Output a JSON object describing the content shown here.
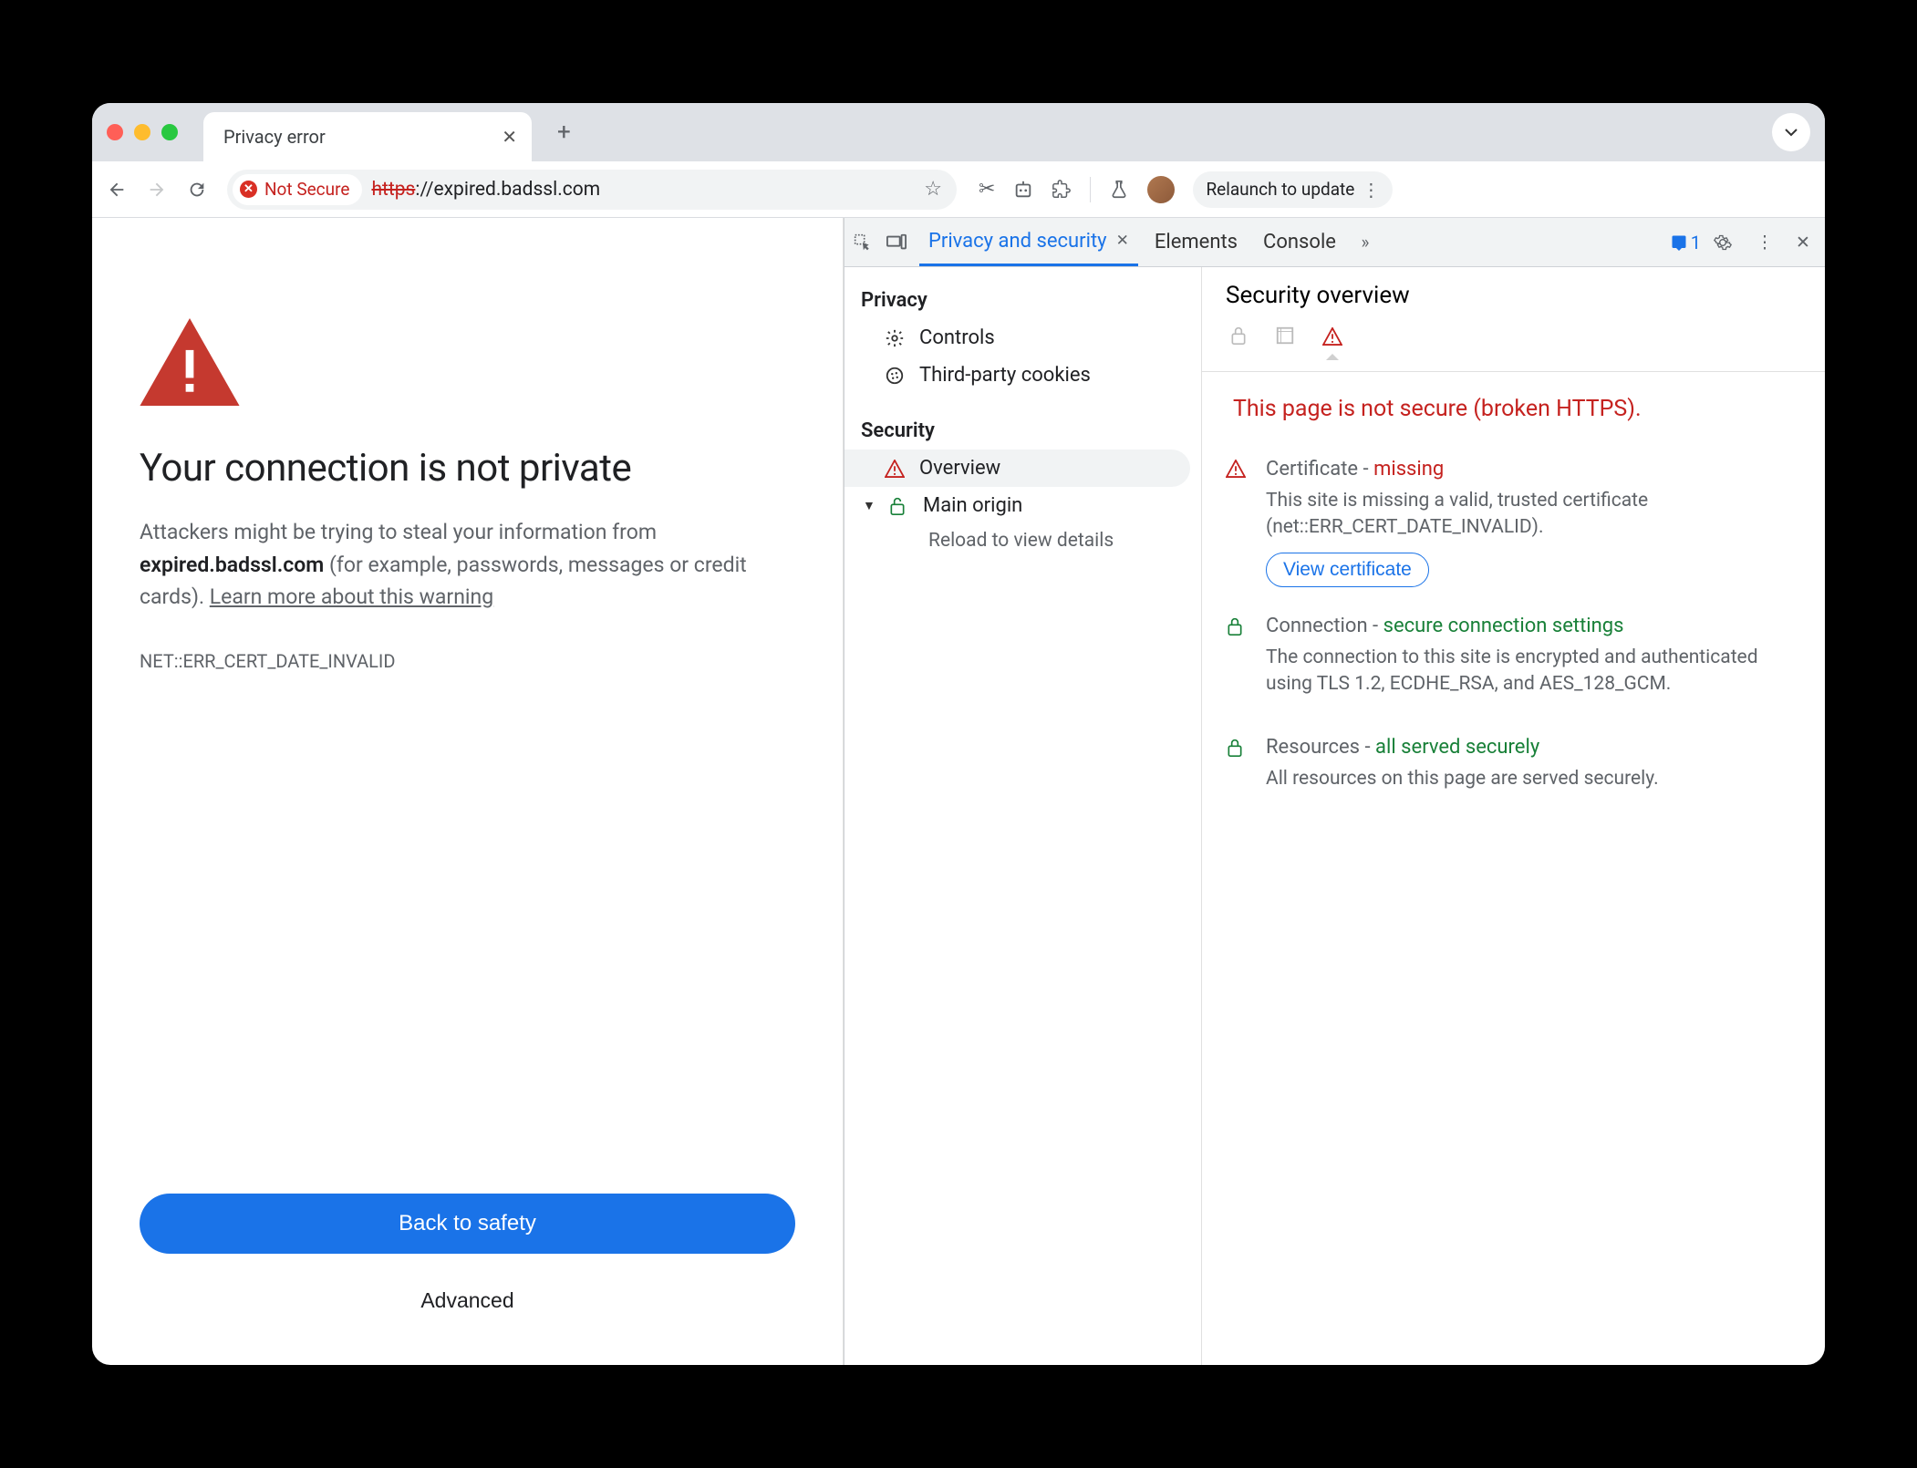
{
  "browser": {
    "tab_title": "Privacy error",
    "security_chip": "Not Secure",
    "url_scheme": "https",
    "url_rest": "://expired.badssl.com",
    "relaunch_label": "Relaunch to update"
  },
  "error_page": {
    "headline": "Your connection is not private",
    "body_prefix": "Attackers might be trying to steal your information from ",
    "body_host": "expired.badssl.com",
    "body_suffix": " (for example, passwords, messages or credit cards). ",
    "learn_more": "Learn more about this warning",
    "error_code": "NET::ERR_CERT_DATE_INVALID",
    "primary_button": "Back to safety",
    "secondary_button": "Advanced"
  },
  "devtools": {
    "tabs": {
      "active": "Privacy and security",
      "elements": "Elements",
      "console": "Console"
    },
    "issues_count": "1",
    "sidebar": {
      "privacy_heading": "Privacy",
      "controls": "Controls",
      "cookies": "Third-party cookies",
      "security_heading": "Security",
      "overview": "Overview",
      "main_origin": "Main origin",
      "reload_hint": "Reload to view details"
    },
    "panel": {
      "title": "Security overview",
      "not_secure_msg": "This page is not secure (broken HTTPS).",
      "cert": {
        "label": "Certificate",
        "status": "missing",
        "desc": "This site is missing a valid, trusted certificate (net::ERR_CERT_DATE_INVALID).",
        "button": "View certificate"
      },
      "conn": {
        "label": "Connection",
        "status": "secure connection settings",
        "desc": "The connection to this site is encrypted and authenticated using TLS 1.2, ECDHE_RSA, and AES_128_GCM."
      },
      "res": {
        "label": "Resources",
        "status": "all served securely",
        "desc": "All resources on this page are served securely."
      }
    }
  }
}
